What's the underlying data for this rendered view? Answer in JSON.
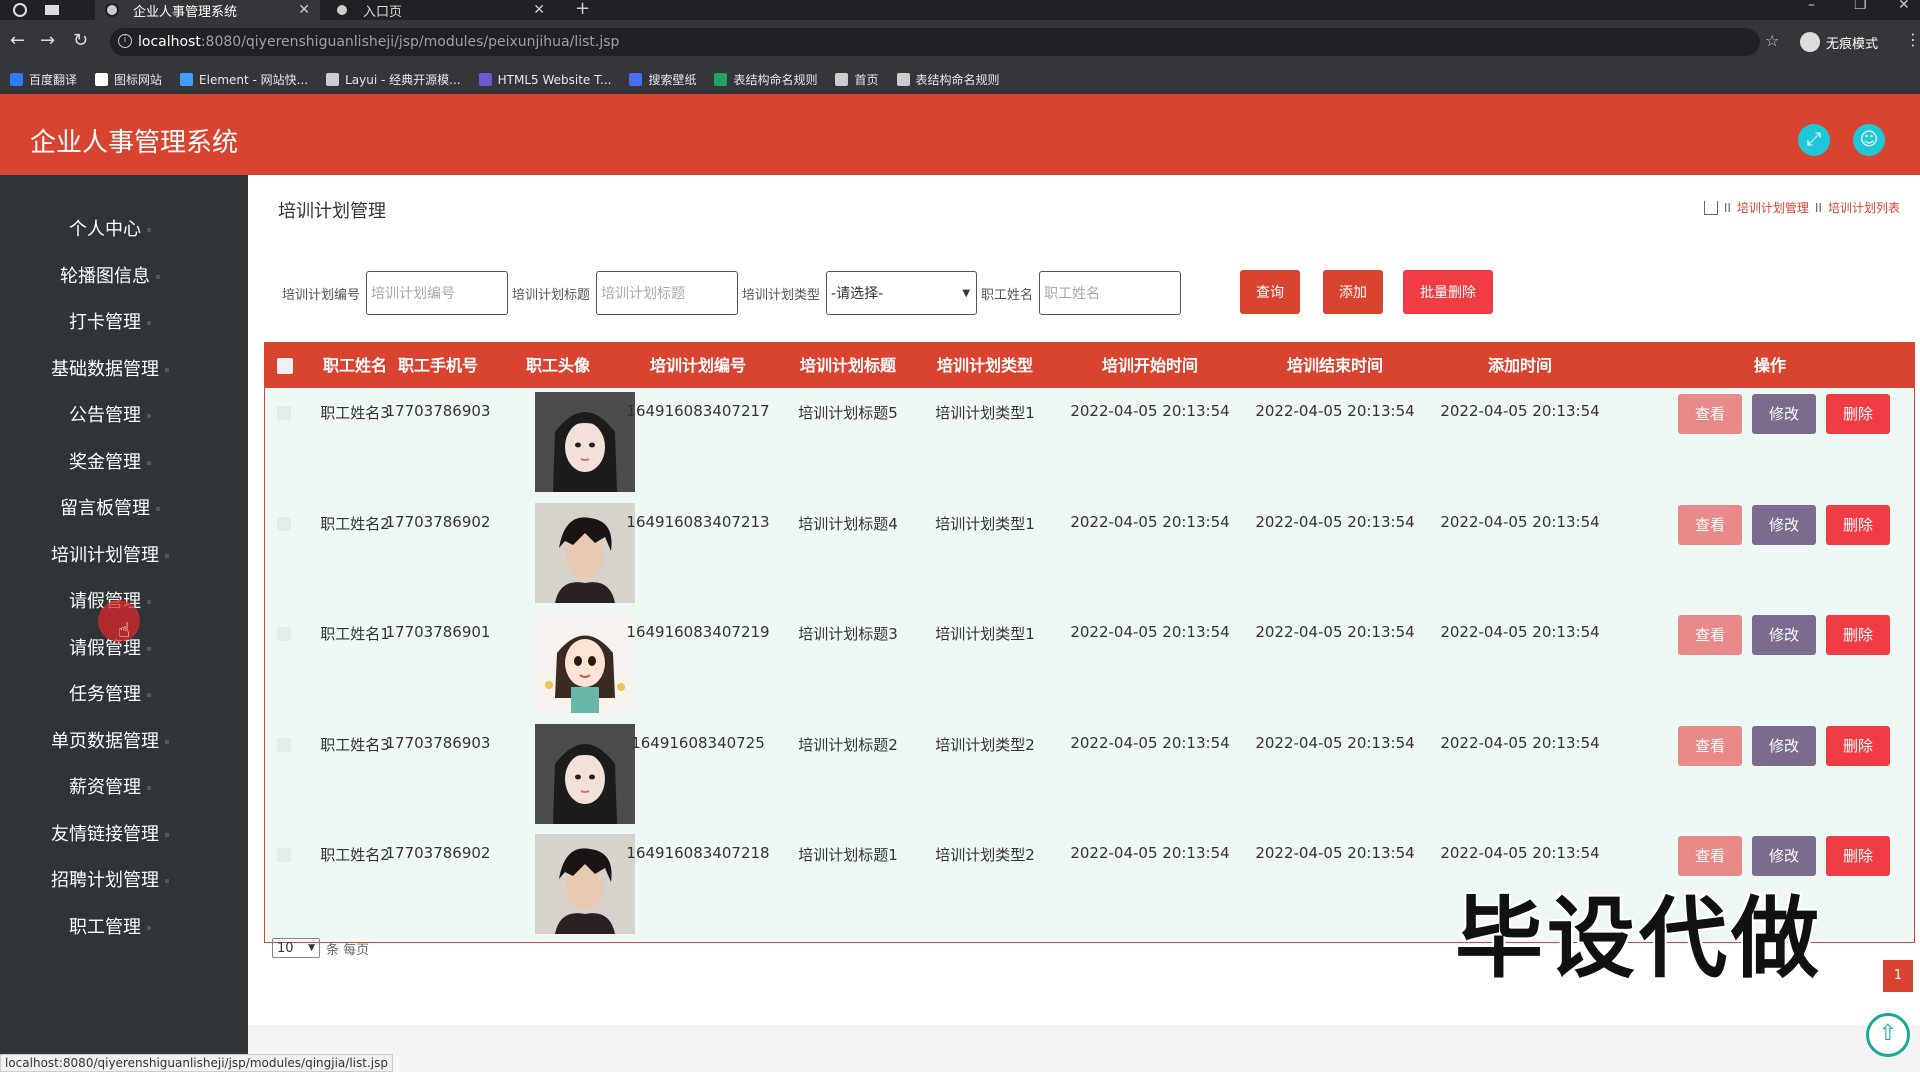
{
  "browser": {
    "tabs": [
      {
        "title": "企业人事管理系统",
        "active": true
      },
      {
        "title": "入口页",
        "active": false
      }
    ],
    "url_host": "localhost",
    "url_path": ":8080/qiyerenshiguanlisheji/jsp/modules/peixunjihua/list.jsp",
    "incognito_label": "无痕模式",
    "bookmarks": [
      {
        "label": "百度翻译",
        "color": "#2e7bf6"
      },
      {
        "label": "图标网站",
        "color": "#ffffff"
      },
      {
        "label": "Element - 网站快...",
        "color": "#409eff"
      },
      {
        "label": "Layui - 经典开源模...",
        "color": "#cccccc"
      },
      {
        "label": "HTML5 Website T...",
        "color": "#6a5acd"
      },
      {
        "label": "搜索壁纸",
        "color": "#4a6cf7"
      },
      {
        "label": "表结构命名规则",
        "color": "#21a366"
      },
      {
        "label": "首页",
        "color": "#cccccc"
      },
      {
        "label": "表结构命名规则",
        "color": "#cccccc"
      }
    ],
    "status_url": "localhost:8080/qiyerenshiguanlisheji/jsp/modules/qingjia/list.jsp"
  },
  "header": {
    "title": "企业人事管理系统",
    "accent": "#d94430"
  },
  "sidebar": {
    "items": [
      {
        "label": "个人中心"
      },
      {
        "label": "轮播图信息"
      },
      {
        "label": "打卡管理"
      },
      {
        "label": "基础数据管理"
      },
      {
        "label": "公告管理"
      },
      {
        "label": "奖金管理"
      },
      {
        "label": "留言板管理"
      },
      {
        "label": "培训计划管理"
      },
      {
        "label": "请假管理"
      },
      {
        "label": "请假管理"
      },
      {
        "label": "任务管理"
      },
      {
        "label": "单页数据管理"
      },
      {
        "label": "薪资管理"
      },
      {
        "label": "友情链接管理"
      },
      {
        "label": "招聘计划管理"
      },
      {
        "label": "职工管理"
      }
    ]
  },
  "main": {
    "page_title": "培训计划管理",
    "breadcrumb": {
      "sep": "II",
      "level1": "培训计划管理",
      "level2": "培训计划列表"
    },
    "search": {
      "code_label": "培训计划编号",
      "code_placeholder": "培训计划编号",
      "title_label": "培训计划标题",
      "title_placeholder": "培训计划标题",
      "type_label": "培训计划类型",
      "type_selected": "-请选择-",
      "name_label": "职工姓名",
      "name_placeholder": "职工姓名",
      "query_btn": "查询",
      "add_btn": "添加",
      "batch_delete_btn": "批量删除"
    },
    "table": {
      "columns": [
        "职工姓名",
        "职工手机号",
        "职工头像",
        "培训计划编号",
        "培训计划标题",
        "培训计划类型",
        "培训开始时间",
        "培训结束时间",
        "添加时间",
        "操作"
      ],
      "actions": {
        "view": "查看",
        "edit": "修改",
        "delete": "删除"
      },
      "rows": [
        {
          "name": "职工姓名3",
          "phone": "17703786903",
          "avatar": "girl-dark-hair",
          "code": "164916083407217",
          "title": "培训计划标题5",
          "type": "培训计划类型1",
          "start": "2022-04-05 20:13:54",
          "end": "2022-04-05 20:13:54",
          "added": "2022-04-05 20:13:54"
        },
        {
          "name": "职工姓名2",
          "phone": "17703786902",
          "avatar": "boy-dark-hair",
          "code": "164916083407213",
          "title": "培训计划标题4",
          "type": "培训计划类型1",
          "start": "2022-04-05 20:13:54",
          "end": "2022-04-05 20:13:54",
          "added": "2022-04-05 20:13:54"
        },
        {
          "name": "职工姓名1",
          "phone": "17703786901",
          "avatar": "cartoon-girl",
          "code": "164916083407219",
          "title": "培训计划标题3",
          "type": "培训计划类型1",
          "start": "2022-04-05 20:13:54",
          "end": "2022-04-05 20:13:54",
          "added": "2022-04-05 20:13:54"
        },
        {
          "name": "职工姓名3",
          "phone": "17703786903",
          "avatar": "girl-dark-hair",
          "code": "16491608340725",
          "title": "培训计划标题2",
          "type": "培训计划类型2",
          "start": "2022-04-05 20:13:54",
          "end": "2022-04-05 20:13:54",
          "added": "2022-04-05 20:13:54"
        },
        {
          "name": "职工姓名2",
          "phone": "17703786902",
          "avatar": "boy-dark-hair",
          "code": "164916083407218",
          "title": "培训计划标题1",
          "type": "培训计划类型2",
          "start": "2022-04-05 20:13:54",
          "end": "2022-04-05 20:13:54",
          "added": "2022-04-05 20:13:54"
        }
      ]
    },
    "pager": {
      "page_size": "10",
      "per_page_label": "条 每页",
      "current_page": "1"
    }
  },
  "watermark": "毕设代做"
}
